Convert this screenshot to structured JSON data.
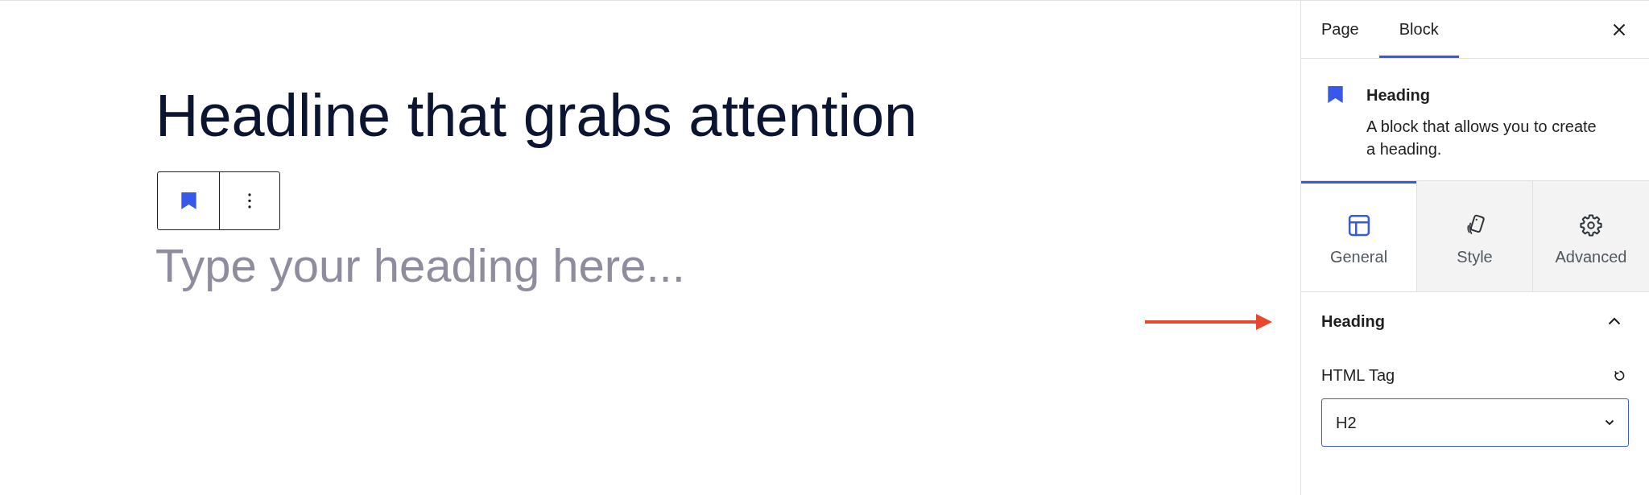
{
  "editor": {
    "heading": "Headline that grabs attention",
    "new_heading": {
      "placeholder": "Type your heading here..."
    }
  },
  "sidebar": {
    "tabs": [
      {
        "label": "Page",
        "selected": false
      },
      {
        "label": "Block",
        "selected": true
      }
    ],
    "block_card": {
      "title": "Heading",
      "description": "A block that allows you to create a heading."
    },
    "inspector_tabs": [
      {
        "label": "General",
        "selected": true
      },
      {
        "label": "Style",
        "selected": false
      },
      {
        "label": "Advanced",
        "selected": false
      }
    ],
    "panel": {
      "title": "Heading",
      "expanded": true,
      "fields": [
        {
          "label": "HTML Tag",
          "value": "H2"
        }
      ]
    }
  }
}
